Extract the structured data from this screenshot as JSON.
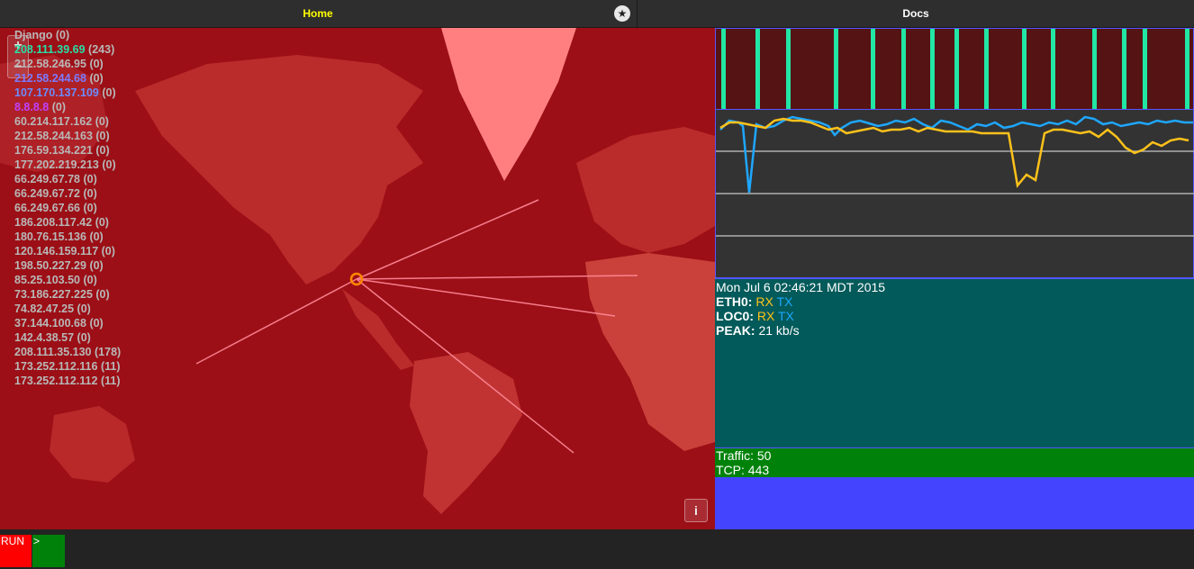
{
  "tabs": {
    "home": "Home",
    "docs": "Docs",
    "star": "★"
  },
  "map": {
    "zoom_in": "+",
    "zoom_out": "−",
    "info_label": "i",
    "hosts": [
      {
        "addr": "Django",
        "count": "(0)",
        "color": "#b8b8b8"
      },
      {
        "addr": "208.111.39.69",
        "count": "(243)",
        "color": "#27e0a8"
      },
      {
        "addr": "212.58.246.95",
        "count": "(0)",
        "color": "#b8b8b8"
      },
      {
        "addr": "212.58.244.68",
        "count": "(0)",
        "color": "#7b7bff"
      },
      {
        "addr": "107.170.137.109",
        "count": "(0)",
        "color": "#6a8cff"
      },
      {
        "addr": "8.8.8.8",
        "count": "(0)",
        "color": "#c040ff"
      },
      {
        "addr": "60.214.117.162",
        "count": "(0)",
        "color": "#b8b8b8"
      },
      {
        "addr": "212.58.244.163",
        "count": "(0)",
        "color": "#b8b8b8"
      },
      {
        "addr": "176.59.134.221",
        "count": "(0)",
        "color": "#b8b8b8"
      },
      {
        "addr": "177.202.219.213",
        "count": "(0)",
        "color": "#b8b8b8"
      },
      {
        "addr": "66.249.67.78",
        "count": "(0)",
        "color": "#b8b8b8"
      },
      {
        "addr": "66.249.67.72",
        "count": "(0)",
        "color": "#b8b8b8"
      },
      {
        "addr": "66.249.67.66",
        "count": "(0)",
        "color": "#b8b8b8"
      },
      {
        "addr": "186.208.117.42",
        "count": "(0)",
        "color": "#b8b8b8"
      },
      {
        "addr": "180.76.15.136",
        "count": "(0)",
        "color": "#b8b8b8"
      },
      {
        "addr": "120.146.159.117",
        "count": "(0)",
        "color": "#b8b8b8"
      },
      {
        "addr": "198.50.227.29",
        "count": "(0)",
        "color": "#b8b8b8"
      },
      {
        "addr": "85.25.103.50",
        "count": "(0)",
        "color": "#b8b8b8"
      },
      {
        "addr": "73.186.227.225",
        "count": "(0)",
        "color": "#b8b8b8"
      },
      {
        "addr": "74.82.47.25",
        "count": "(0)",
        "color": "#b8b8b8"
      },
      {
        "addr": "37.144.100.68",
        "count": "(0)",
        "color": "#b8b8b8"
      },
      {
        "addr": "142.4.38.57",
        "count": "(0)",
        "color": "#b8b8b8"
      },
      {
        "addr": "208.111.35.130",
        "count": "(178)",
        "color": "#b8b8b8"
      },
      {
        "addr": "173.252.112.116",
        "count": "(11)",
        "color": "#b8b8b8"
      },
      {
        "addr": "173.252.112.112",
        "count": "(11)",
        "color": "#b8b8b8"
      }
    ]
  },
  "status": {
    "datetime": "Mon Jul 6 02:46:21 MDT 2015",
    "eth0_label": "ETH0:",
    "loc0_label": "LOC0:",
    "rx": "RX",
    "tx": "TX",
    "peak_label": "PEAK:",
    "peak_value": "21 kb/s"
  },
  "traffic": {
    "traffic_line": "Traffic: 50",
    "tcp_line": "TCP: 443"
  },
  "bottom": {
    "run_label": "RUN",
    "prompt_label": ">"
  },
  "colors": {
    "rx": "#ffc21a",
    "tx": "#1ea7ff",
    "pulse": "#22e6a4"
  }
}
